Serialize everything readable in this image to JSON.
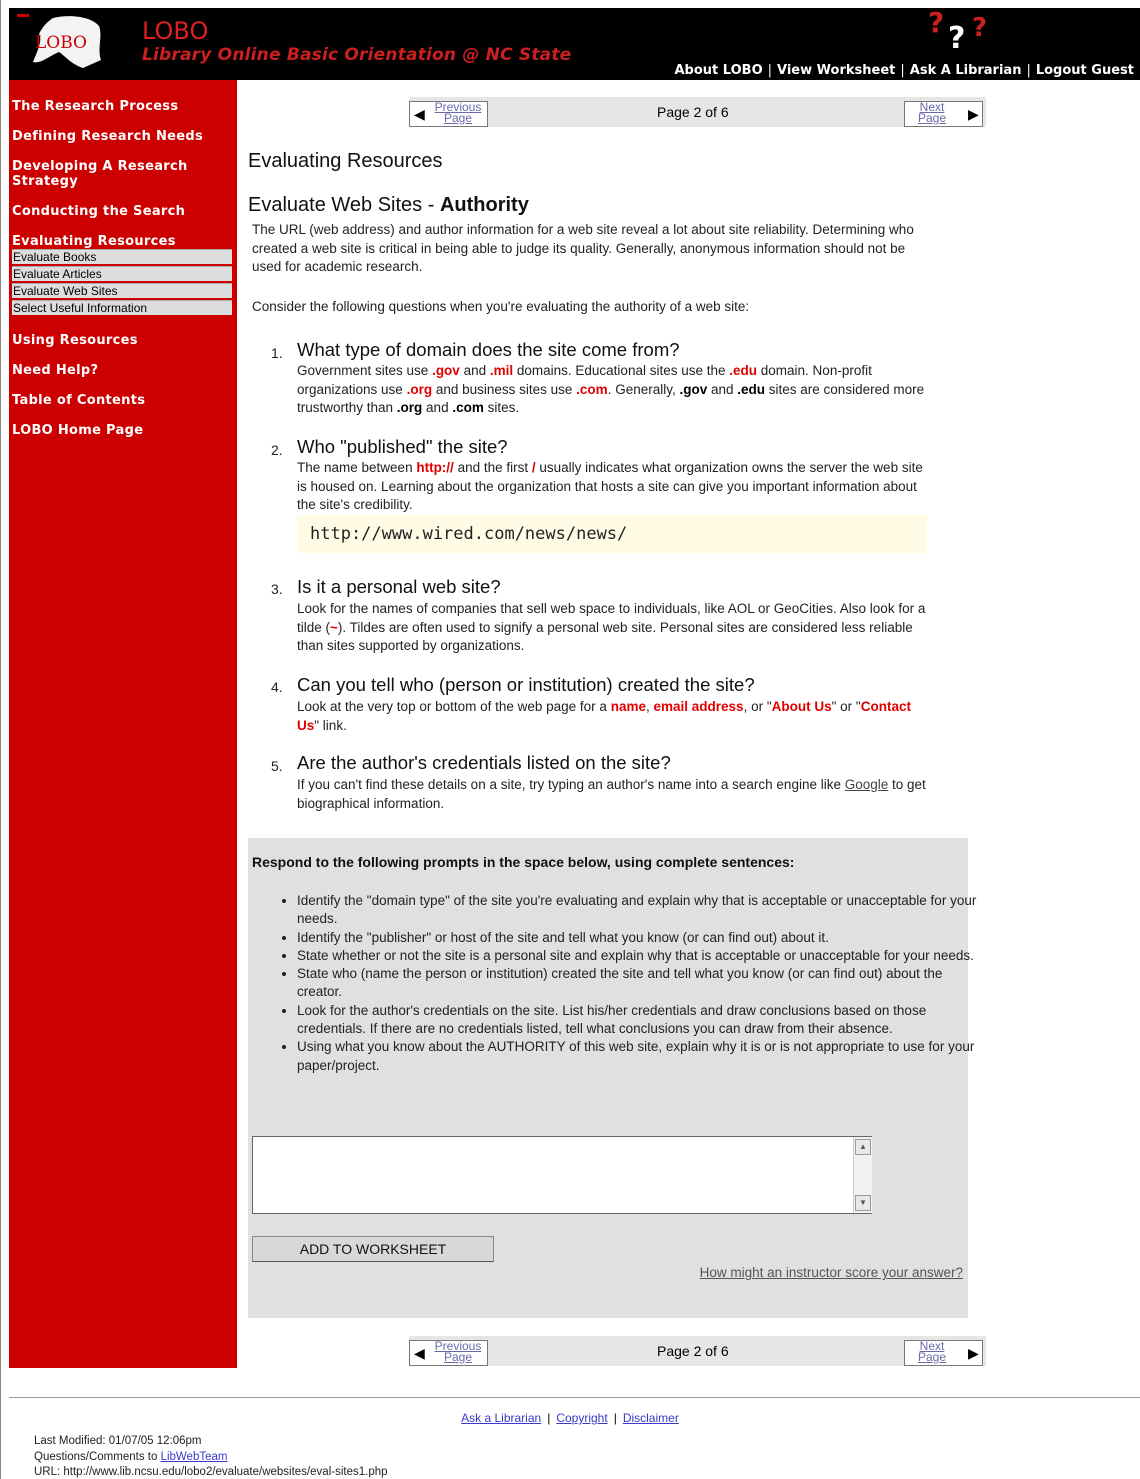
{
  "header": {
    "title": "LOBO",
    "subtitle": "Library Online Basic Orientation @ NC State",
    "logo_text": "LOBO",
    "nav": [
      "About LOBO",
      "View Worksheet",
      "Ask A Librarian",
      "Logout Guest"
    ],
    "qmark_icon": "question-marks-icon"
  },
  "sidebar": {
    "items": [
      {
        "label": "The Research Process"
      },
      {
        "label": "Defining Research Needs"
      },
      {
        "label": "Developing A Research Strategy"
      },
      {
        "label": "Conducting the Search"
      },
      {
        "label": "Evaluating Resources"
      },
      {
        "label": "Using Resources"
      },
      {
        "label": "Need Help?"
      },
      {
        "label": "Table of Contents"
      },
      {
        "label": "LOBO Home Page"
      }
    ],
    "subitems": [
      "Evaluate Books",
      "Evaluate Articles",
      "Evaluate Web Sites",
      "Select Useful Information"
    ]
  },
  "pager": {
    "previous": [
      "Previous",
      "Page"
    ],
    "next": [
      "Next",
      "Page"
    ],
    "status": "Page 2 of 6"
  },
  "content": {
    "section": "Evaluating Resources",
    "title_prefix": "Evaluate Web Sites - ",
    "title_bold": "Authority",
    "intro": "The URL (web address) and author information for a web site reveal a lot about site reliability. Determining who created a web site is critical in being able to judge its quality. Generally, anonymous information should not be used for academic research.",
    "consider": "Consider the following questions when you're evaluating the authority of a web site:",
    "questions": [
      {
        "num": "1.",
        "title": "What type of domain does the site come from?",
        "body": [
          {
            "t": "Government sites use "
          },
          {
            "t": ".gov",
            "s": "red"
          },
          {
            "t": " and "
          },
          {
            "t": ".mil",
            "s": "red"
          },
          {
            "t": " domains. Educational sites use the "
          },
          {
            "t": ".edu",
            "s": "red"
          },
          {
            "t": " domain. Non-profit organizations use "
          },
          {
            "t": ".org",
            "s": "red"
          },
          {
            "t": " and business sites use "
          },
          {
            "t": ".com",
            "s": "red"
          },
          {
            "t": ". Generally, "
          },
          {
            "t": ".gov",
            "s": "blk"
          },
          {
            "t": " and "
          },
          {
            "t": ".edu",
            "s": "blk"
          },
          {
            "t": " sites are considered more trustworthy than "
          },
          {
            "t": ".org",
            "s": "blk"
          },
          {
            "t": " and "
          },
          {
            "t": ".com",
            "s": "blk"
          },
          {
            "t": " sites."
          }
        ]
      },
      {
        "num": "2.",
        "title": "Who \"published\" the site?",
        "body": [
          {
            "t": "The name between "
          },
          {
            "t": "http://",
            "s": "red"
          },
          {
            "t": " and the first "
          },
          {
            "t": "/",
            "s": "red"
          },
          {
            "t": " usually indicates what organization owns the server the web site is housed on. Learning about the organization that hosts a site can give you important information about the site's credibility."
          }
        ]
      },
      {
        "num": "3.",
        "title": "Is it a personal web site?",
        "body": [
          {
            "t": "Look for the names of companies that sell web space to individuals, like AOL or GeoCities. Also look for a tilde ("
          },
          {
            "t": "~",
            "s": "red"
          },
          {
            "t": "). Tildes are often used to signify a personal web site. Personal sites are considered less reliable than sites supported by organizations."
          }
        ]
      },
      {
        "num": "4.",
        "title": "Can you tell who (person or institution) created the site?",
        "body": [
          {
            "t": "Look at the very top or bottom of the web page for a "
          },
          {
            "t": "name",
            "s": "red"
          },
          {
            "t": ", "
          },
          {
            "t": "email address",
            "s": "red"
          },
          {
            "t": ", or \""
          },
          {
            "t": "About Us",
            "s": "red"
          },
          {
            "t": "\" or \""
          },
          {
            "t": "Contact Us",
            "s": "red"
          },
          {
            "t": "\" link."
          }
        ]
      },
      {
        "num": "5.",
        "title": "Are the author's credentials listed on the site?",
        "body": [
          {
            "t": "If you can't find these details on a site, try typing an author's name into a search engine like "
          },
          {
            "t": "Google",
            "s": "ulink"
          },
          {
            "t": " to get biographical information."
          }
        ]
      }
    ],
    "url_example": "http://www.wired.com/news/news/"
  },
  "respond": {
    "prompt": "Respond to the following prompts in the space below, using complete sentences:",
    "bullets": [
      "Identify the \"domain type\" of the site you're evaluating and explain why that is acceptable or unacceptable for your needs.",
      "Identify the \"publisher\" or host of the site and tell what you know (or can find out) about it.",
      "State whether or not the site is a personal site and explain why that is acceptable or unacceptable for your needs.",
      "State who (name the person or institution) created the site and tell what you know (or can find out) about the creator.",
      "Look for the author's credentials on the site. List his/her credentials and draw conclusions based on those credentials. If there are no credentials listed, tell what conclusions you can draw from their absence.",
      "Using what you know about the AUTHORITY of this web site, explain why it is or is not appropriate to use for your paper/project."
    ],
    "answer_value": "",
    "add_button": "ADD TO WORKSHEET",
    "score_link": "How might an instructor score your answer?"
  },
  "footer": {
    "links": [
      "Ask a Librarian",
      "Copyright",
      "Disclaimer"
    ],
    "separator": "|",
    "modified": "Last Modified: 01/07/05 12:06pm",
    "questions_prefix": "Questions/Comments to ",
    "questions_link": "LibWebTeam",
    "url": "URL: http://www.lib.ncsu.edu/lobo2/evaluate/websites/eval-sites1.php"
  },
  "colors": {
    "sidebar": "#cc0000",
    "header": "#000000",
    "accent_red": "#e00000"
  }
}
